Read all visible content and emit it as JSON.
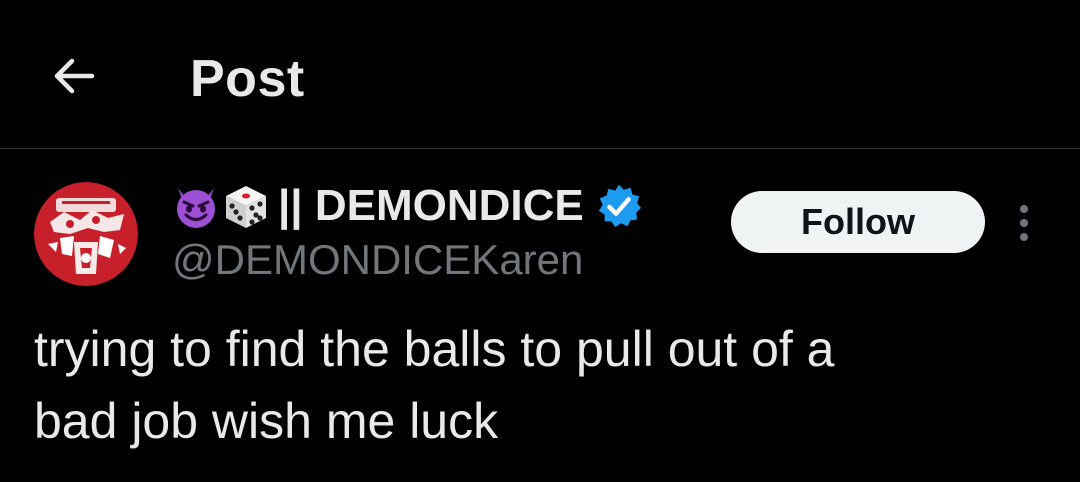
{
  "header": {
    "title": "Post",
    "back_icon": "arrow-left-icon"
  },
  "author": {
    "emoji_icons": [
      "smiling-imp-icon",
      "game-die-icon"
    ],
    "display_name": "|| DEMONDICE",
    "verified": true,
    "verified_icon": "verified-badge-icon",
    "handle": "@DEMONDICEKaren",
    "avatar_icon": "avatar-image"
  },
  "actions": {
    "follow_label": "Follow",
    "more_icon": "more-vertical-icon"
  },
  "post": {
    "text": "trying to find the balls to pull out of a\nbad job wish me luck"
  },
  "colors": {
    "background": "#000000",
    "text_primary": "#e7e9ea",
    "text_secondary": "#71767b",
    "divider": "#2f3336",
    "follow_bg": "#eff3f4",
    "verified_blue": "#1d9bf0",
    "avatar_red": "#c8202a"
  }
}
